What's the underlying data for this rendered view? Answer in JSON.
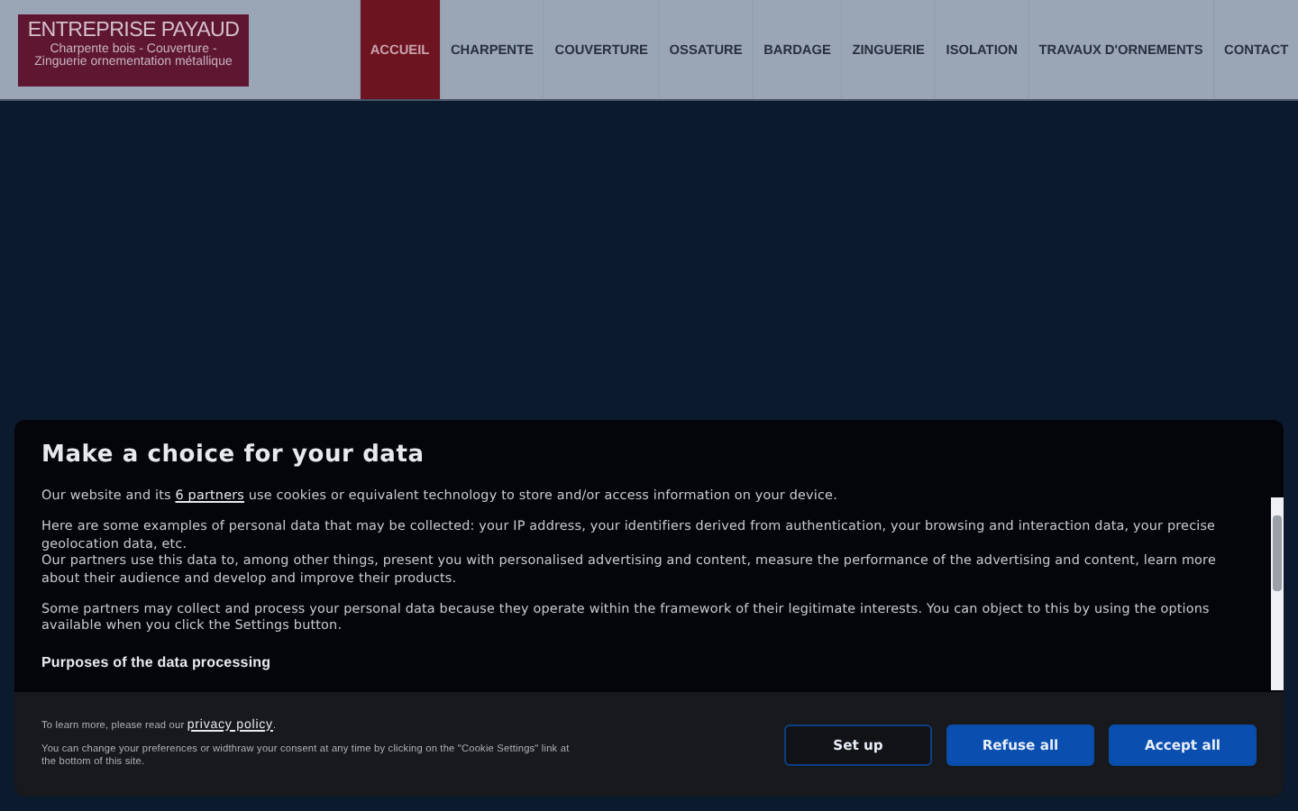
{
  "header": {
    "logo": {
      "title": "ENTREPRISE PAYAUD",
      "subtitle": "Charpente bois - Couverture - Zinguerie ornementation métallique"
    },
    "nav": [
      {
        "label": "ACCUEIL",
        "selected": true
      },
      {
        "label": "CHARPENTE",
        "selected": false
      },
      {
        "label": "COUVERTURE",
        "selected": false
      },
      {
        "label": "OSSATURE",
        "selected": false
      },
      {
        "label": "BARDAGE",
        "selected": false
      },
      {
        "label": "ZINGUERIE",
        "selected": false
      },
      {
        "label": "ISOLATION",
        "selected": false
      },
      {
        "label": "TRAVAUX D'ORNEMENTS",
        "selected": false
      },
      {
        "label": "CONTACT",
        "selected": false
      }
    ]
  },
  "consent": {
    "title": "Make a choice for your data",
    "paragraphs": [
      {
        "before": "Our website and its ",
        "link": "6 partners",
        "after": " use cookies or equivalent technology to store and/or access information on your device.",
        "kind": "paragraph"
      },
      {
        "before": "Here are some examples of personal data that may be collected: your IP address, your identifiers derived from authentication, your browsing and interaction data, your precise geolocation data, etc.",
        "kind": "paragraph"
      },
      {
        "before": "Our partners use this data to, among other things, present you with personalised advertising and content, measure the performance of the advertising and content, learn more about their audience and develop and improve their products.",
        "kind": "continued"
      },
      {
        "before": "Some partners may collect and process your personal data because they operate within the framework of their legitimate interests. You can object to this by using the options available when you click the Settings button.",
        "kind": "paragraph"
      },
      {
        "before": "Purposes of the data processing",
        "kind": "heading"
      }
    ],
    "privacy": {
      "before": "To learn more, please read our ",
      "link": "privacy policy",
      "after": "."
    },
    "notice": "You can change your preferences or widthraw your consent at any time by clicking on the \"Cookie Settings\" link at the bottom of this site.",
    "buttons": [
      {
        "label": "Set up",
        "kind": "outline"
      },
      {
        "label": "Refuse all",
        "kind": "primary"
      },
      {
        "label": "Accept all",
        "kind": "primary"
      }
    ]
  }
}
